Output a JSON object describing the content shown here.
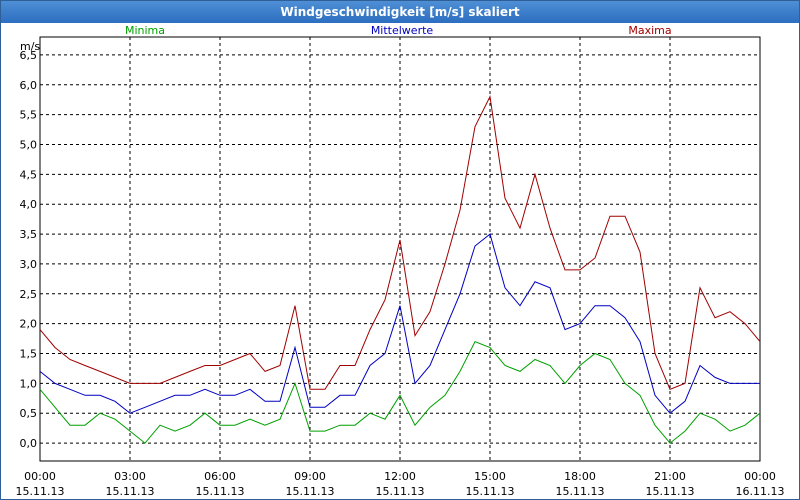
{
  "window": {
    "title": "Windgeschwindigkeit [m/s] skaliert"
  },
  "chart_data": {
    "type": "line",
    "title": "Windgeschwindigkeit [m/s] skaliert",
    "ylabel": "m/s",
    "ylim": [
      -0.3,
      6.8
    ],
    "yticks": [
      "0,0",
      "0,5",
      "1,0",
      "1,5",
      "2,0",
      "2,5",
      "3,0",
      "3,5",
      "4,0",
      "4,5",
      "5,0",
      "5,5",
      "6,0",
      "6,5"
    ],
    "xticks": [
      {
        "time": "00:00",
        "date": "15.11.13"
      },
      {
        "time": "03:00",
        "date": "15.11.13"
      },
      {
        "time": "06:00",
        "date": "15.11.13"
      },
      {
        "time": "09:00",
        "date": "15.11.13"
      },
      {
        "time": "12:00",
        "date": "15.11.13"
      },
      {
        "time": "15:00",
        "date": "15.11.13"
      },
      {
        "time": "18:00",
        "date": "15.11.13"
      },
      {
        "time": "21:00",
        "date": "15.11.13"
      },
      {
        "time": "00:00",
        "date": "16.11.13"
      }
    ],
    "x_hours": [
      0,
      0.5,
      1,
      1.5,
      2,
      2.5,
      3,
      3.5,
      4,
      4.5,
      5,
      5.5,
      6,
      6.5,
      7,
      7.5,
      8,
      8.5,
      9,
      9.5,
      10,
      10.5,
      11,
      11.5,
      12,
      12.5,
      13,
      13.5,
      14,
      14.5,
      15,
      15.5,
      16,
      16.5,
      17,
      17.5,
      18,
      18.5,
      19,
      19.5,
      20,
      20.5,
      21,
      21.5,
      22,
      22.5,
      23,
      23.5,
      24
    ],
    "grid": true,
    "series": [
      {
        "name": "Minima",
        "color": "#00a000",
        "values": [
          0.9,
          0.6,
          0.3,
          0.3,
          0.5,
          0.4,
          0.2,
          0.0,
          0.3,
          0.2,
          0.3,
          0.5,
          0.3,
          0.3,
          0.4,
          0.3,
          0.4,
          1.0,
          0.2,
          0.2,
          0.3,
          0.3,
          0.5,
          0.4,
          0.8,
          0.3,
          0.6,
          0.8,
          1.2,
          1.7,
          1.6,
          1.3,
          1.2,
          1.4,
          1.3,
          1.0,
          1.3,
          1.5,
          1.4,
          1.0,
          0.8,
          0.3,
          0.0,
          0.2,
          0.5,
          0.4,
          0.2,
          0.3,
          0.5
        ]
      },
      {
        "name": "Mittelwerte",
        "color": "#0000c0",
        "values": [
          1.2,
          1.0,
          0.9,
          0.8,
          0.8,
          0.7,
          0.5,
          0.6,
          0.7,
          0.8,
          0.8,
          0.9,
          0.8,
          0.8,
          0.9,
          0.7,
          0.7,
          1.6,
          0.6,
          0.6,
          0.8,
          0.8,
          1.3,
          1.5,
          2.3,
          1.0,
          1.3,
          1.9,
          2.5,
          3.3,
          3.5,
          2.6,
          2.3,
          2.7,
          2.6,
          1.9,
          2.0,
          2.3,
          2.3,
          2.1,
          1.7,
          0.8,
          0.5,
          0.7,
          1.3,
          1.1,
          1.0,
          1.0,
          1.0
        ]
      },
      {
        "name": "Maxima",
        "color": "#a00000",
        "values": [
          1.9,
          1.6,
          1.4,
          1.3,
          1.2,
          1.1,
          1.0,
          1.0,
          1.0,
          1.1,
          1.2,
          1.3,
          1.3,
          1.4,
          1.5,
          1.2,
          1.3,
          2.3,
          0.9,
          0.9,
          1.3,
          1.3,
          1.9,
          2.4,
          3.4,
          1.8,
          2.2,
          3.0,
          3.9,
          5.3,
          5.8,
          4.1,
          3.6,
          4.5,
          3.6,
          2.9,
          2.9,
          3.1,
          3.8,
          3.8,
          3.2,
          1.5,
          0.9,
          1.0,
          2.6,
          2.1,
          2.2,
          2.0,
          1.7
        ]
      }
    ]
  },
  "colors": {
    "titlebar_top": "#4f8fd6",
    "titlebar_bottom": "#2c6ec0",
    "border": "#2e5f96"
  }
}
